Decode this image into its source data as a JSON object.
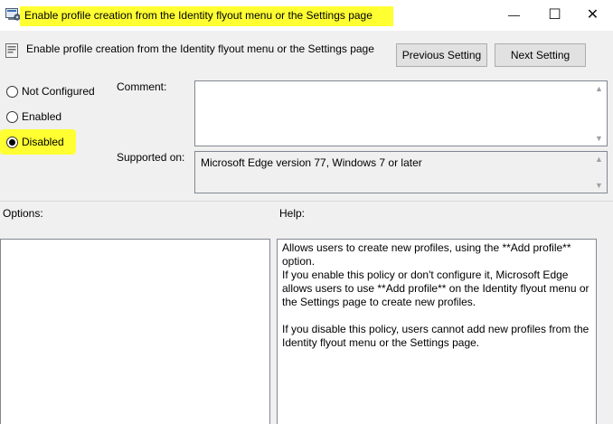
{
  "window": {
    "title": "Enable profile creation from the Identity flyout menu or the Settings page",
    "minimize_glyph": "—",
    "maximize_glyph": "☐",
    "close_glyph": "✕",
    "highlight_color": "#ffff32"
  },
  "header": {
    "policy_name": "Enable profile creation from the Identity flyout menu or the Settings page",
    "previous_label": "Previous Setting",
    "next_label": "Next Setting"
  },
  "state": {
    "options": [
      {
        "label": "Not Configured",
        "checked": false
      },
      {
        "label": "Enabled",
        "checked": false
      },
      {
        "label": "Disabled",
        "checked": true
      }
    ]
  },
  "comment": {
    "label": "Comment:",
    "value": ""
  },
  "supported": {
    "label": "Supported on:",
    "value": "Microsoft Edge version 77, Windows 7 or later"
  },
  "options_pane": {
    "label": "Options:"
  },
  "help_pane": {
    "label": "Help:",
    "paragraphs": [
      "Allows users to create new profiles, using the **Add profile** option.",
      "If you enable this policy or don't configure it, Microsoft Edge allows users to use **Add profile** on the Identity flyout menu or the Settings page to create new profiles.",
      "If you disable this policy, users cannot add new profiles from the Identity flyout menu or the Settings page."
    ]
  },
  "icons": {
    "title_icon": "policy-settings-icon",
    "header_icon": "policy-document-icon"
  }
}
